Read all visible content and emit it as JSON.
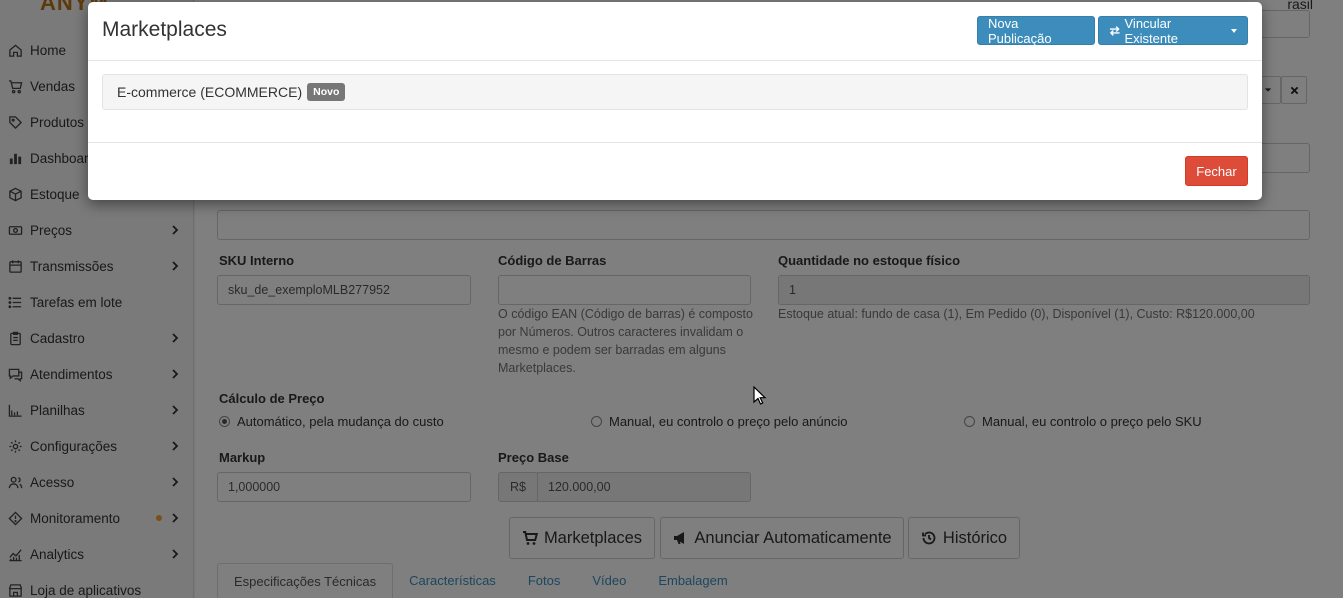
{
  "sidebar": {
    "logo": "ANYM",
    "items": [
      {
        "label": "Home",
        "icon": "home-icon",
        "has_children": false
      },
      {
        "label": "Vendas",
        "icon": "cart-icon",
        "has_children": false
      },
      {
        "label": "Produtos",
        "icon": "tag-icon",
        "has_children": false
      },
      {
        "label": "Dashboard",
        "icon": "bar-chart-icon",
        "has_children": false
      },
      {
        "label": "Estoque",
        "icon": "box-icon",
        "has_children": false
      },
      {
        "label": "Preços",
        "icon": "money-icon",
        "has_children": true
      },
      {
        "label": "Transmissões",
        "icon": "calendar-icon",
        "has_children": true
      },
      {
        "label": "Tarefas em lote",
        "icon": "list-icon",
        "has_children": false
      },
      {
        "label": "Cadastro",
        "icon": "clipboard-icon",
        "has_children": true
      },
      {
        "label": "Atendimentos",
        "icon": "chat-icon",
        "has_children": true
      },
      {
        "label": "Planilhas",
        "icon": "spreadsheet-icon",
        "has_children": true
      },
      {
        "label": "Configurações",
        "icon": "gear-icon",
        "has_children": true
      },
      {
        "label": "Acesso",
        "icon": "users-icon",
        "has_children": true
      },
      {
        "label": "Monitoramento",
        "icon": "diamond-alert-icon",
        "has_children": true,
        "dot": true
      },
      {
        "label": "Analytics",
        "icon": "line-chart-icon",
        "has_children": true
      },
      {
        "label": "Loja de aplicativos",
        "icon": "store-icon",
        "has_children": false
      }
    ]
  },
  "topbar": {
    "region": "rasil"
  },
  "form": {
    "sku_label": "SKU Interno",
    "sku_value": "sku_de_exemploMLB277952",
    "barcode_label": "Código de Barras",
    "barcode_value": "",
    "barcode_help": "O código EAN (Código de barras) é composto por Números. Outros caracteres invalidam o mesmo e podem ser barradas em alguns Marketplaces.",
    "stock_label": "Quantidade no estoque físico",
    "stock_value": "1",
    "stock_help": "Estoque atual: fundo de casa (1), Em Pedido (0), Disponível (1), Custo: R$120.000,00",
    "pricing_label": "Cálculo de Preço",
    "pricing_options": [
      {
        "label": "Automático, pela mudança do custo",
        "selected": true
      },
      {
        "label": "Manual, eu controlo o preço pelo anúncio",
        "selected": false
      },
      {
        "label": "Manual, eu controlo o preço pelo SKU",
        "selected": false
      }
    ],
    "markup_label": "Markup",
    "markup_value": "1,000000",
    "base_price_label": "Preço Base",
    "currency_prefix": "R$",
    "base_price_value": "120.000,00"
  },
  "actions": {
    "marketplaces": "Marketplaces",
    "auto_publish": "Anunciar Automaticamente",
    "history": "Histórico"
  },
  "tabs": [
    {
      "label": "Especificações Técnicas",
      "active": true
    },
    {
      "label": "Características",
      "active": false
    },
    {
      "label": "Fotos",
      "active": false
    },
    {
      "label": "Vídeo",
      "active": false
    },
    {
      "label": "Embalagem",
      "active": false
    }
  ],
  "modal": {
    "title": "Marketplaces",
    "new_publication": "Nova Publicação",
    "link_existing": "Vincular Existente",
    "marketplace_entry": "E-commerce (ECOMMERCE)",
    "badge": "Novo",
    "close": "Fechar"
  },
  "colors": {
    "primary": "#3c8dbc",
    "danger": "#dd4b39",
    "badge": "#777777",
    "notification_dot": "#f0a030"
  }
}
